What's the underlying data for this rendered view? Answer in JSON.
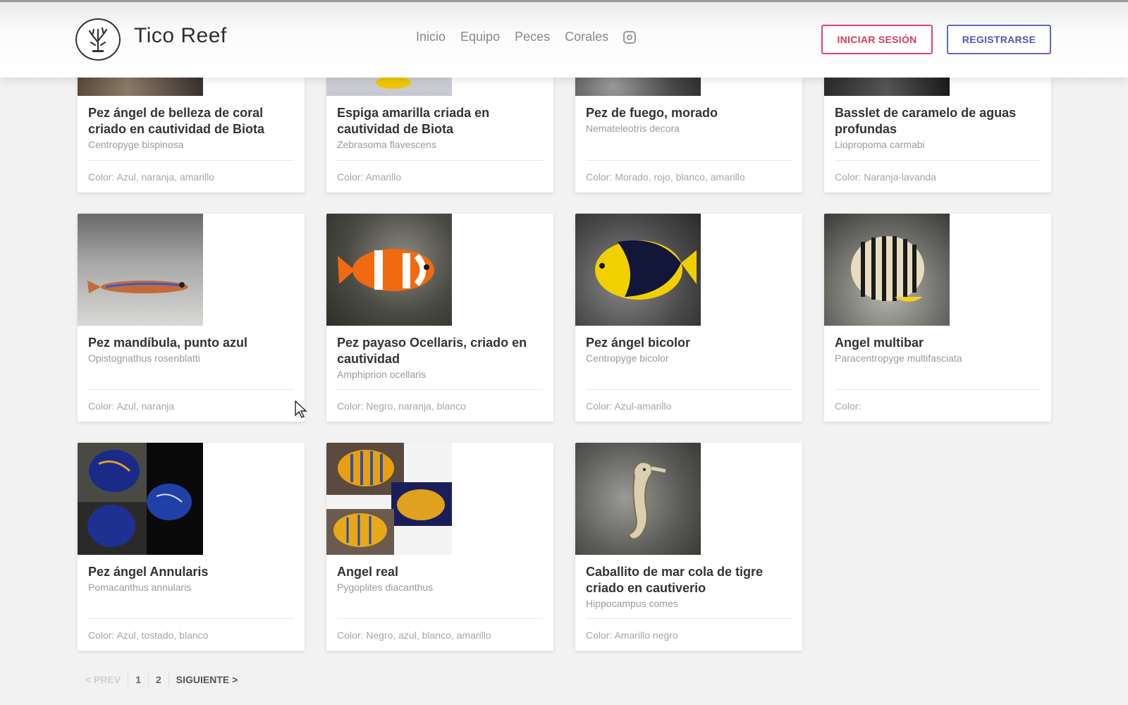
{
  "brand": {
    "name": "Tico Reef"
  },
  "nav": {
    "items": [
      "Inicio",
      "Equipo",
      "Peces",
      "Corales"
    ],
    "instagram_icon": "instagram-icon"
  },
  "auth": {
    "login": "INICIAR SESIÓN",
    "register": "REGISTRARSE"
  },
  "colors": {
    "login_accent": "#d23a60",
    "register_accent": "#5056b9",
    "background": "#f2f2f2"
  },
  "cards": [
    {
      "title": "Pez ángel de belleza de coral criado en cautividad de Biota",
      "sci": "Centropyge bispinosa",
      "color": "Color: Azul, naranja, amarillo"
    },
    {
      "title": "Espiga amarilla criada en cautividad de Biota",
      "sci": "Zebrasoma flavescens",
      "color": "Color: Amarillo"
    },
    {
      "title": "Pez de fuego, morado",
      "sci": "Nemateleotris decora",
      "color": "Color: Morado, rojo, blanco, amarillo"
    },
    {
      "title": "Basslet de caramelo de aguas profundas",
      "sci": "Liopropoma carmabi",
      "color": "Color: Naranja-lavanda"
    },
    {
      "title": "Pez mandíbula, punto azul",
      "sci": "Opistognathus rosenblatti",
      "color": "Color: Azul, naranja"
    },
    {
      "title": "Pez payaso Ocellaris, criado en cautividad",
      "sci": "Amphiprion ocellaris",
      "color": "Color: Negro, naranja, blanco"
    },
    {
      "title": "Pez ángel bicolor",
      "sci": "Centropyge bicolor",
      "color": "Color: Azul-amarillo"
    },
    {
      "title": "Angel multibar",
      "sci": "Paracentropyge multifasciata",
      "color": "Color:"
    },
    {
      "title": "Pez ángel Annularis",
      "sci": "Pomacanthus annularis",
      "color": "Color: Azul, tostado, blanco"
    },
    {
      "title": "Angel real",
      "sci": "Pygoplites diacanthus",
      "color": "Color: Negro, azul, blanco, amarillo"
    },
    {
      "title": "Caballito de mar cola de tigre criado en cautiverio",
      "sci": "Hippocampus comes",
      "color": "Color: Amarillo negro"
    }
  ],
  "pagination": {
    "prev": "< PREV",
    "pages": [
      "1",
      "2"
    ],
    "next": "SIGUIENTE >"
  }
}
